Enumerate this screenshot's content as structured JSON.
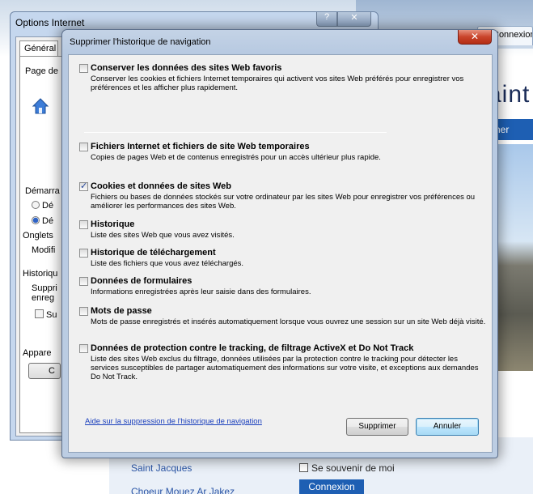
{
  "browser": {
    "tab_label": "Connexion",
    "heading_fragment": "aint",
    "search_button": "rcher",
    "link_1": "Saint Jacques",
    "link_2": "Choeur Mouez Ar Jakez",
    "remember_label": "Se souvenir de moi",
    "connect_button": "Connexion"
  },
  "options_window": {
    "title": "Options Internet",
    "help": "?",
    "close": "✕",
    "tab": "Général",
    "labels": {
      "home": "Page de",
      "startup": "Démarra",
      "radio1": "Dé",
      "radio2": "Dé",
      "tabs": "Onglets",
      "modify": "Modifi",
      "history": "Historiqu",
      "history_desc1": "Suppri",
      "history_desc2": "enreg",
      "history_check": "Su",
      "appearance": "Appare",
      "button": "C"
    }
  },
  "dialog": {
    "title": "Supprimer l'historique de navigation",
    "close": "✕",
    "items": [
      {
        "title": "Conserver les données des sites Web favoris",
        "desc": "Conserver les cookies et fichiers Internet temporaires qui activent vos sites Web préférés pour enregistrer vos préférences et les afficher plus rapidement.",
        "checked": false
      },
      {
        "title": "Fichiers Internet et fichiers de site Web temporaires",
        "desc": "Copies de pages Web et de contenus enregistrés pour un accès ultérieur plus rapide.",
        "checked": false
      },
      {
        "title": "Cookies et données de sites Web",
        "desc": "Fichiers ou bases de données stockés sur votre ordinateur par les sites Web pour enregistrer vos préférences ou améliorer les performances des sites Web.",
        "checked": true
      },
      {
        "title": "Historique",
        "desc": "Liste des sites Web que vous avez visités.",
        "checked": false
      },
      {
        "title": "Historique de téléchargement",
        "desc": "Liste des fichiers que vous avez téléchargés.",
        "checked": false
      },
      {
        "title": "Données de formulaires",
        "desc": "Informations enregistrées après leur saisie dans des formulaires.",
        "checked": false
      },
      {
        "title": "Mots de passe",
        "desc": "Mots de passe enregistrés et insérés automatiquement lorsque vous ouvrez une session sur un site Web déjà visité.",
        "checked": false
      },
      {
        "title": "Données de protection contre le tracking, de filtrage ActiveX et Do Not Track",
        "desc": "Liste des sites Web exclus du filtrage, données utilisées par la protection contre le tracking pour détecter les services susceptibles de partager automatiquement des informations sur votre visite, et exceptions aux demandes Do Not Track.",
        "checked": false
      }
    ],
    "help_link": "Aide sur la suppression de l'historique de navigation",
    "delete_button": "Supprimer",
    "cancel_button": "Annuler"
  }
}
